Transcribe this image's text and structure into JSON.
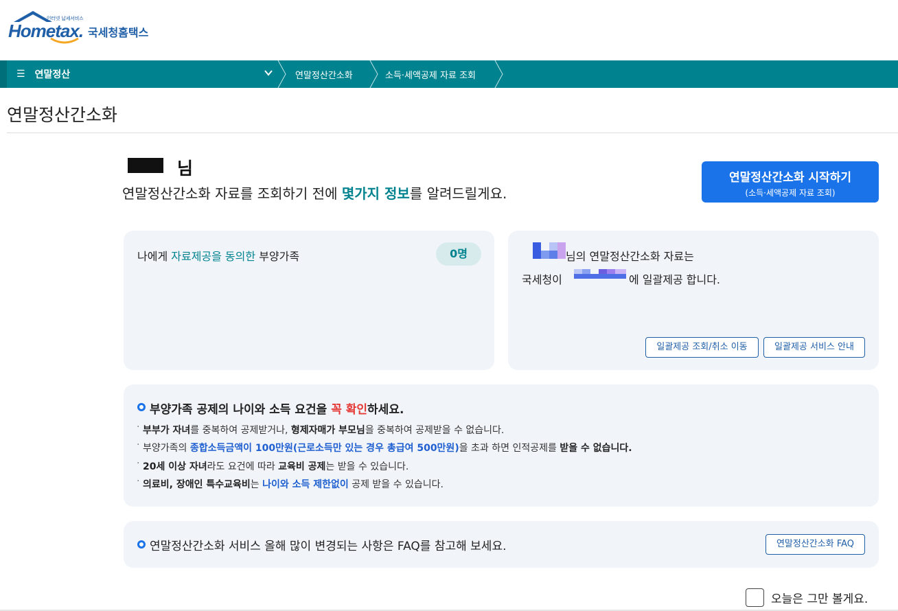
{
  "logo": {
    "brand": "Hometax.",
    "tagline": "인터넷 납세서비스",
    "name_kr": "국세청홈택스"
  },
  "nav": {
    "menu_label": "연말정산",
    "breadcrumbs": [
      "연말정산간소화",
      "소득·세액공제 자료 조회"
    ]
  },
  "page": {
    "title": "연말정산간소화"
  },
  "greeting": {
    "suffix": "님",
    "intro_before": "연말정산간소화 자료를 조회하기 전에 ",
    "intro_highlight": "몇가지 정보",
    "intro_after": "를 알려드릴게요."
  },
  "start_button": {
    "label": "연말정산간소화 시작하기",
    "sublabel": "(소득·세액공제 자료 조회)"
  },
  "consent_card": {
    "label_before": "나에게 ",
    "label_highlight": "자료제공을 동의한",
    "label_after": " 부양가족",
    "count": "0명"
  },
  "bulk_card": {
    "line1": "님의 연말정산간소화 자료는",
    "line2_before": "국세청이",
    "line2_after": "에 일괄제공 합니다.",
    "btn_manage": "일괄제공 조회/취소 이동",
    "btn_guide": "일괄제공 서비스 안내"
  },
  "requirements": {
    "title_before": "부양가족 공제의 나이와 소득 요건을 ",
    "title_highlight": "꼭 확인",
    "title_after": "하세요.",
    "r1": {
      "a": "부부가 자녀",
      "b": "를 중복하여 공제받거나, ",
      "c": "형제자매가 부모님",
      "d": "을 중복하여 공제받을 수 없습니다."
    },
    "r2": {
      "a": "부양가족의 ",
      "b": "종합소득금액이 100만원(근로소득만 있는 경우 총급여 500만원)",
      "c": "을 초과 하면 인적공제를 ",
      "d": "받을 수 없습니다."
    },
    "r3": {
      "a": "20세 이상 자녀",
      "b": "라도 요건에 따라 ",
      "c": "교육비 공제",
      "d": "는 받을 수 있습니다."
    },
    "r4": {
      "a": "의료비, 장애인 특수교육비",
      "b": "는 ",
      "c": "나이와 소득 제한없이",
      "d": " 공제 받을 수 있습니다."
    }
  },
  "faq": {
    "text": "연말정산간소화 서비스 올해 많이 변경되는 사항은 FAQ를 참고해 보세요.",
    "button": "연말정산간소화 FAQ"
  },
  "dismiss": {
    "label": "오늘은 그만 볼게요.",
    "checked": false
  },
  "colors": {
    "teal": "#00838f",
    "primary_blue": "#1a73e8",
    "card_bg": "#f1f5fa",
    "red": "#e53935"
  }
}
